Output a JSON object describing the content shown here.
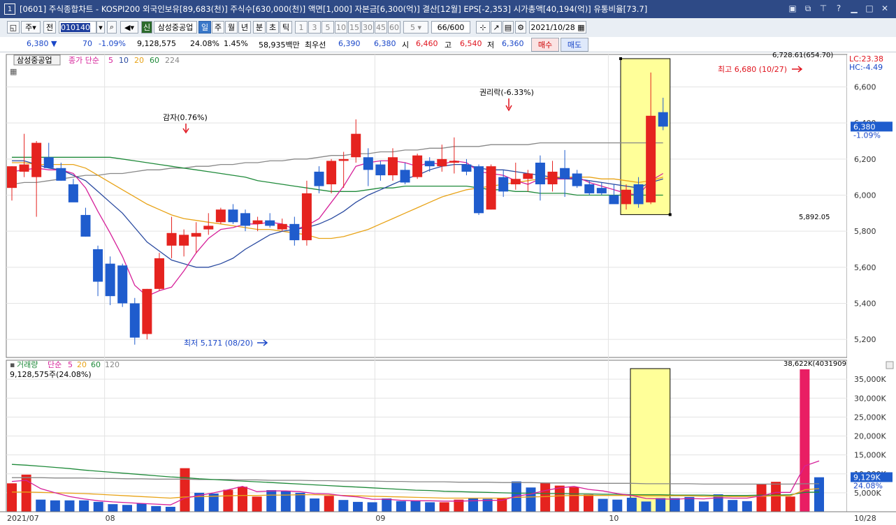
{
  "titlebar": {
    "num": "1",
    "title": "[0601] 주식종합차트 - KOSPI200 외국인보유[89,683(천)] 주식수[630,000(천)] 액면[1,000] 자본금[6,300(억)] 결산[12월] EPS[-2,353] 시가총액[40,194(억)] 유통비율[73.7]"
  },
  "toolbar": {
    "period_select": "주",
    "prev": "전",
    "code": "010140",
    "badge": "신",
    "name": "삼성중공업",
    "units": [
      "일",
      "주",
      "월",
      "년",
      "분",
      "초",
      "틱"
    ],
    "minutes": [
      "1",
      "3",
      "5",
      "10",
      "15",
      "30",
      "45",
      "60"
    ],
    "interval_value": "5",
    "count": "66",
    "count_max": "/600",
    "date": "2021/10/28"
  },
  "quote": {
    "price": "6,380",
    "change": "70",
    "change_pct": "-1.09%",
    "volume": "9,128,575",
    "vol_pct": "24.08%",
    "turnover": "1.45%",
    "amount": "58,935백만",
    "pref_label": "최우선",
    "ask": "6,390",
    "bid": "6,380",
    "open_label": "시",
    "open": "6,460",
    "high_label": "고",
    "high": "6,540",
    "low_label": "저",
    "low": "6,360",
    "buy": "매수",
    "sell": "매도"
  },
  "legend_price": {
    "name": "삼성중공업",
    "label": "종가 단순",
    "ma": [
      "5",
      "10",
      "20",
      "60",
      "224"
    ]
  },
  "legend_volume": {
    "name": "거래량",
    "label": "단순",
    "ma": [
      "5",
      "20",
      "60",
      "120"
    ],
    "current": "9,128,575주(24.08%)"
  },
  "annotations": {
    "capital_reduction": "감자(0.76%)",
    "ex_rights": "권리락(-6.33%)",
    "high_note": "최고 6,680 (10/27)",
    "low_note": "최저 5,171 (08/20)",
    "sel_top": "6,728.61(654.70)",
    "sel_bottom": "5,892.05",
    "vol_top": "38,622K(4031909"
  },
  "right_axis": {
    "lc": "LC:23.38",
    "hc": "HC:-4.49",
    "price_tag": "6,380",
    "price_tag_pct": "-1.09%",
    "vol_tag": "9,129K",
    "vol_tag_pct": "24.08%"
  },
  "x_labels": [
    "2021/07",
    "08",
    "09",
    "10",
    "10/28"
  ],
  "colors": {
    "up": "#e5231f",
    "down": "#1f5ccd",
    "ma5": "#d6219a",
    "ma10": "#2a4aa0",
    "ma20": "#e8a317",
    "ma60": "#1f8a3a",
    "ma224": "#888888",
    "highlight": "#ffff99"
  },
  "chart_data": [
    {
      "type": "candlestick",
      "title": "삼성중공업",
      "ylim": [
        5100,
        6780
      ],
      "yticks": [
        5200,
        5400,
        5600,
        5800,
        6000,
        6200,
        6400,
        6600
      ],
      "ytick_labels": [
        "5,200",
        "5,400",
        "5,600",
        "5,800",
        "6,000",
        "6,200",
        "6,400",
        "6,600"
      ],
      "candles": [
        {
          "o": 6040,
          "h": 6160,
          "l": 5970,
          "c": 6160
        },
        {
          "o": 6130,
          "h": 6340,
          "l": 6100,
          "c": 6170
        },
        {
          "o": 6100,
          "h": 6300,
          "l": 5880,
          "c": 6290
        },
        {
          "o": 6210,
          "h": 6290,
          "l": 6150,
          "c": 6150
        },
        {
          "o": 6150,
          "h": 6180,
          "l": 6080,
          "c": 6080
        },
        {
          "o": 6060,
          "h": 6090,
          "l": 5980,
          "c": 5960
        },
        {
          "o": 5890,
          "h": 5930,
          "l": 5770,
          "c": 5770
        },
        {
          "o": 5700,
          "h": 5720,
          "l": 5440,
          "c": 5520
        },
        {
          "o": 5620,
          "h": 5660,
          "l": 5390,
          "c": 5440
        },
        {
          "o": 5610,
          "h": 5620,
          "l": 5380,
          "c": 5400
        },
        {
          "o": 5400,
          "h": 5430,
          "l": 5171,
          "c": 5210
        },
        {
          "o": 5230,
          "h": 5480,
          "l": 5200,
          "c": 5480
        },
        {
          "o": 5480,
          "h": 5680,
          "l": 5470,
          "c": 5650
        },
        {
          "o": 5720,
          "h": 5880,
          "l": 5650,
          "c": 5790
        },
        {
          "o": 5720,
          "h": 5810,
          "l": 5660,
          "c": 5780
        },
        {
          "o": 5770,
          "h": 5850,
          "l": 5680,
          "c": 5790
        },
        {
          "o": 5810,
          "h": 5900,
          "l": 5780,
          "c": 5830
        },
        {
          "o": 5850,
          "h": 5930,
          "l": 5840,
          "c": 5920
        },
        {
          "o": 5920,
          "h": 5950,
          "l": 5840,
          "c": 5850
        },
        {
          "o": 5900,
          "h": 5920,
          "l": 5800,
          "c": 5830
        },
        {
          "o": 5840,
          "h": 5880,
          "l": 5800,
          "c": 5860
        },
        {
          "o": 5860,
          "h": 5900,
          "l": 5820,
          "c": 5830
        },
        {
          "o": 5810,
          "h": 5870,
          "l": 5800,
          "c": 5840
        },
        {
          "o": 5840,
          "h": 5880,
          "l": 5720,
          "c": 5750
        },
        {
          "o": 5750,
          "h": 6080,
          "l": 5720,
          "c": 6010
        },
        {
          "o": 6130,
          "h": 6160,
          "l": 6010,
          "c": 6050
        },
        {
          "o": 6060,
          "h": 6200,
          "l": 6010,
          "c": 6190
        },
        {
          "o": 6190,
          "h": 6240,
          "l": 6040,
          "c": 6200
        },
        {
          "o": 6210,
          "h": 6420,
          "l": 6180,
          "c": 6340
        },
        {
          "o": 6210,
          "h": 6260,
          "l": 6050,
          "c": 6140
        },
        {
          "o": 6170,
          "h": 6190,
          "l": 6080,
          "c": 6110
        },
        {
          "o": 6110,
          "h": 6260,
          "l": 6080,
          "c": 6210
        },
        {
          "o": 6140,
          "h": 6180,
          "l": 6060,
          "c": 6070
        },
        {
          "o": 6100,
          "h": 6230,
          "l": 6090,
          "c": 6220
        },
        {
          "o": 6190,
          "h": 6210,
          "l": 6130,
          "c": 6160
        },
        {
          "o": 6160,
          "h": 6280,
          "l": 6130,
          "c": 6200
        },
        {
          "o": 6180,
          "h": 6320,
          "l": 6120,
          "c": 6190
        },
        {
          "o": 6170,
          "h": 6200,
          "l": 6110,
          "c": 6130
        },
        {
          "o": 6160,
          "h": 6170,
          "l": 5890,
          "c": 5900
        },
        {
          "o": 5920,
          "h": 6170,
          "l": 5920,
          "c": 6160
        },
        {
          "o": 6100,
          "h": 6140,
          "l": 5990,
          "c": 6020
        },
        {
          "o": 6060,
          "h": 6180,
          "l": 6030,
          "c": 6090
        },
        {
          "o": 6090,
          "h": 6140,
          "l": 6020,
          "c": 6120
        },
        {
          "o": 6180,
          "h": 6220,
          "l": 5970,
          "c": 6060
        },
        {
          "o": 6060,
          "h": 6190,
          "l": 6020,
          "c": 6130
        },
        {
          "o": 6150,
          "h": 6250,
          "l": 5990,
          "c": 6090
        },
        {
          "o": 6120,
          "h": 6140,
          "l": 6040,
          "c": 6050
        },
        {
          "o": 6060,
          "h": 6080,
          "l": 6000,
          "c": 6010
        },
        {
          "o": 6040,
          "h": 6070,
          "l": 6000,
          "c": 6010
        },
        {
          "o": 6000,
          "h": 6060,
          "l": 5960,
          "c": 5950
        },
        {
          "o": 5950,
          "h": 6060,
          "l": 5920,
          "c": 6030
        },
        {
          "o": 6060,
          "h": 6100,
          "l": 5930,
          "c": 5950
        },
        {
          "o": 5960,
          "h": 6680,
          "l": 5950,
          "c": 6440
        },
        {
          "o": 6460,
          "h": 6540,
          "l": 6360,
          "c": 6380
        }
      ],
      "ma5": [
        6130,
        6140,
        6150,
        6140,
        6140,
        6120,
        6040,
        5910,
        5790,
        5660,
        5500,
        5440,
        5470,
        5490,
        5580,
        5680,
        5760,
        5810,
        5820,
        5840,
        5840,
        5850,
        5840,
        5810,
        5830,
        5870,
        5960,
        6050,
        6160,
        6180,
        6190,
        6190,
        6180,
        6160,
        6180,
        6170,
        6190,
        6180,
        6130,
        6120,
        6110,
        6080,
        6060,
        6090,
        6090,
        6090,
        6100,
        6070,
        6050,
        6030,
        6010,
        6000,
        6080,
        6120
      ],
      "ma10": [
        6190,
        6190,
        6170,
        6150,
        6140,
        6110,
        6080,
        6020,
        5960,
        5900,
        5820,
        5740,
        5690,
        5640,
        5620,
        5600,
        5600,
        5620,
        5650,
        5700,
        5740,
        5780,
        5800,
        5810,
        5820,
        5840,
        5870,
        5910,
        5960,
        6000,
        6030,
        6060,
        6090,
        6110,
        6140,
        6160,
        6170,
        6170,
        6150,
        6140,
        6140,
        6130,
        6120,
        6110,
        6100,
        6090,
        6090,
        6080,
        6070,
        6060,
        6050,
        6040,
        6070,
        6090
      ],
      "ma20": [
        6180,
        6180,
        6170,
        6170,
        6170,
        6170,
        6150,
        6110,
        6070,
        6030,
        5990,
        5950,
        5920,
        5890,
        5870,
        5860,
        5850,
        5840,
        5830,
        5820,
        5810,
        5810,
        5800,
        5790,
        5780,
        5760,
        5760,
        5770,
        5790,
        5810,
        5840,
        5870,
        5900,
        5930,
        5960,
        5990,
        6010,
        6030,
        6040,
        6050,
        6060,
        6070,
        6080,
        6090,
        6100,
        6100,
        6100,
        6100,
        6090,
        6090,
        6080,
        6070,
        6080,
        6100
      ],
      "ma60": [
        6210,
        6210,
        6210,
        6210,
        6210,
        6210,
        6210,
        6210,
        6210,
        6200,
        6190,
        6180,
        6170,
        6160,
        6150,
        6140,
        6130,
        6120,
        6110,
        6100,
        6080,
        6070,
        6060,
        6050,
        6040,
        6030,
        6020,
        6020,
        6020,
        6030,
        6040,
        6040,
        6050,
        6050,
        6050,
        6050,
        6050,
        6050,
        6040,
        6030,
        6030,
        6020,
        6020,
        6010,
        6010,
        6010,
        6000,
        6000,
        6000,
        6000,
        6000,
        6000,
        6000,
        6000
      ],
      "ma224": [
        6060,
        6070,
        6070,
        6080,
        6090,
        6100,
        6110,
        6110,
        6120,
        6120,
        6130,
        6140,
        6140,
        6150,
        6150,
        6160,
        6160,
        6170,
        6170,
        6180,
        6180,
        6190,
        6190,
        6200,
        6200,
        6210,
        6220,
        6220,
        6230,
        6230,
        6240,
        6240,
        6250,
        6250,
        6260,
        6260,
        6270,
        6270,
        6270,
        6280,
        6280,
        6280,
        6280,
        6290,
        6290,
        6290,
        6290,
        6290,
        6290,
        6290,
        6290,
        6290,
        6290,
        6290
      ]
    },
    {
      "type": "bar",
      "title": "거래량",
      "ylim": [
        0,
        40000
      ],
      "yticks": [
        5000,
        10000,
        15000,
        20000,
        25000,
        30000,
        35000
      ],
      "ytick_labels": [
        "5,000K",
        "10,000K",
        "15,000K",
        "20,000K",
        "25,000K",
        "30,000K",
        "35,000K"
      ],
      "values": [
        7500,
        9800,
        3200,
        3000,
        3000,
        3000,
        2600,
        2000,
        1800,
        2200,
        1500,
        1300,
        11500,
        5000,
        4800,
        5800,
        6600,
        4000,
        5700,
        5500,
        5000,
        3500,
        4200,
        3100,
        2600,
        2500,
        3500,
        2800,
        3000,
        2500,
        2500,
        3200,
        3500,
        3400,
        3500,
        8000,
        6400,
        7700,
        6900,
        6500,
        4500,
        3400,
        3200,
        3700,
        2700,
        3600,
        3600,
        3900,
        2700,
        4600,
        3100,
        2800,
        7200,
        7900,
        4000,
        37600,
        9100
      ],
      "ma5": [
        8000,
        8300,
        6100,
        5000,
        4000,
        3400,
        2900,
        2600,
        2400,
        2200,
        2000,
        1800,
        3600,
        4300,
        5000,
        5800,
        6700,
        5300,
        5500,
        5500,
        5300,
        4800,
        4700,
        4200,
        3900,
        3300,
        3300,
        3000,
        2900,
        2900,
        2800,
        2800,
        2900,
        3000,
        3000,
        4100,
        4700,
        5600,
        6300,
        6700,
        5900,
        5500,
        4800,
        4300,
        3500,
        3400,
        3300,
        3500,
        3400,
        3700,
        3600,
        3600,
        4200,
        5100,
        5100,
        12100,
        13400
      ],
      "ma20": [
        5200,
        5200,
        5100,
        5000,
        4900,
        4800,
        4600,
        4400,
        4200,
        4000,
        3800,
        3600,
        3900,
        4000,
        4100,
        4200,
        4300,
        4300,
        4400,
        4400,
        4500,
        4500,
        4400,
        4300,
        4200,
        4100,
        4000,
        3900,
        3800,
        3700,
        3600,
        3600,
        3600,
        3600,
        3600,
        3800,
        3900,
        4000,
        4200,
        4300,
        4300,
        4300,
        4300,
        4300,
        4200,
        4200,
        4200,
        4200,
        4100,
        4100,
        4000,
        4000,
        4100,
        4200,
        4200,
        5800,
        6100
      ],
      "ma60": [
        12500,
        12300,
        12000,
        11700,
        11400,
        11000,
        10700,
        10400,
        10100,
        9800,
        9500,
        9200,
        9000,
        8700,
        8500,
        8300,
        8100,
        7900,
        7700,
        7500,
        7300,
        7100,
        6900,
        6700,
        6500,
        6300,
        6100,
        5900,
        5700,
        5600,
        5400,
        5300,
        5200,
        5100,
        5000,
        4900,
        4900,
        4800,
        4800,
        4700,
        4700,
        4600,
        4600,
        4500,
        4500,
        4500,
        4400,
        4400,
        4400,
        4300,
        4300,
        4300,
        4400,
        4400,
        4500,
        5100,
        5200
      ],
      "ma120": [
        9000,
        9000,
        9000,
        8900,
        8900,
        8900,
        8800,
        8800,
        8700,
        8700,
        8600,
        8600,
        8600,
        8500,
        8500,
        8500,
        8400,
        8400,
        8300,
        8300,
        8300,
        8200,
        8200,
        8100,
        8100,
        8100,
        8000,
        8000,
        7900,
        7900,
        7900,
        7800,
        7800,
        7800,
        7700,
        7700,
        7700,
        7600,
        7600,
        7600,
        7500,
        7500,
        7500,
        7500,
        7400,
        7400,
        7400,
        7400,
        7300,
        7300,
        7300,
        7300,
        7300,
        7300,
        7300,
        7400,
        7400
      ]
    }
  ]
}
